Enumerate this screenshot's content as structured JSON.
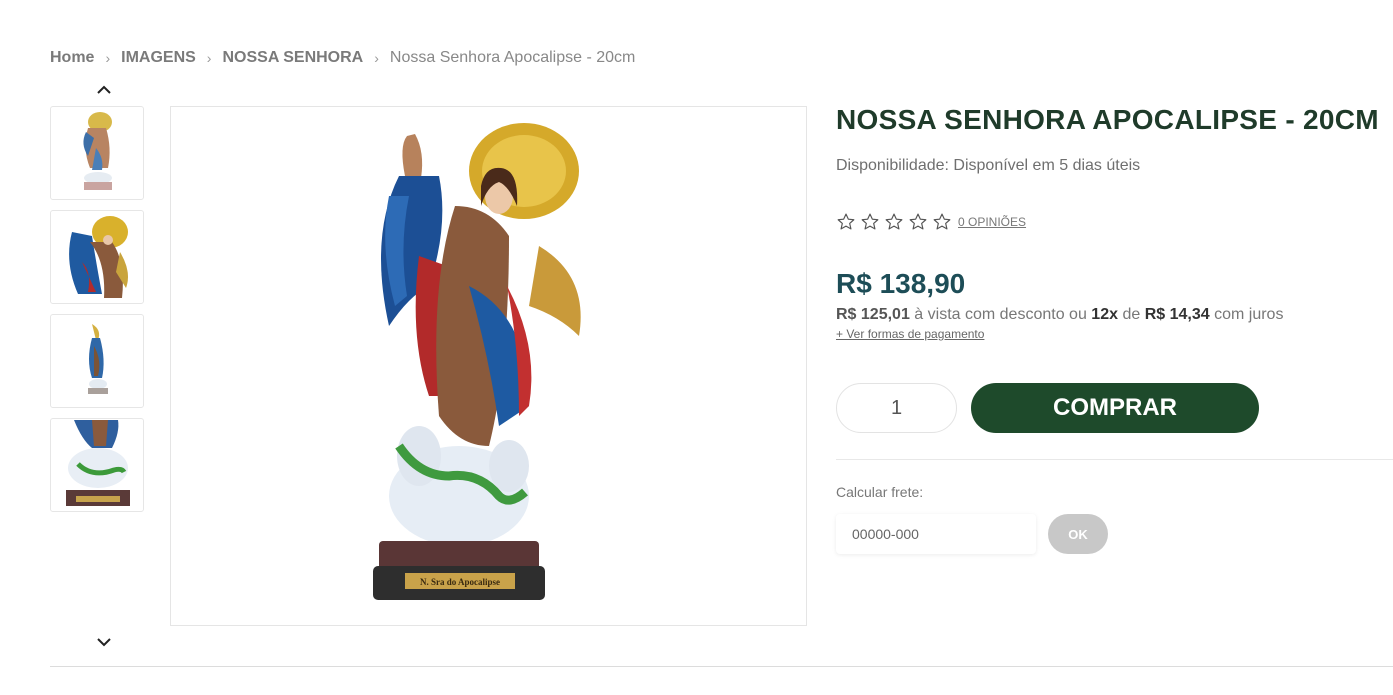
{
  "breadcrumb": {
    "items": [
      "Home",
      "IMAGENS",
      "NOSSA SENHORA"
    ],
    "current": "Nossa Senhora Apocalipse - 20cm",
    "separator": "›"
  },
  "gallery": {
    "thumbnail_count": 4,
    "up_icon": "chevron-up-icon",
    "down_icon": "chevron-down-icon",
    "main_image_plaque": "N. Sra do Apocalipse"
  },
  "product": {
    "title": "NOSSA SENHORA APOCALIPSE - 20CM",
    "availability": "Disponibilidade: Disponível em 5 dias úteis",
    "rating_stars": 0,
    "rating_max": 5,
    "reviews_label": "0 OPINIÕES",
    "price": "R$ 138,90",
    "cash_price": "R$ 125,01",
    "cash_text": "à vista com desconto ou",
    "installments_count": "12x",
    "installments_de": "de",
    "installment_value": "R$ 14,34",
    "installments_suffix": "com juros",
    "payment_link": "+ Ver formas de pagamento"
  },
  "cart": {
    "quantity": "1",
    "buy_label": "COMPRAR"
  },
  "shipping": {
    "label": "Calcular frete:",
    "placeholder": "00000-000",
    "ok_label": "OK"
  },
  "colors": {
    "title": "#1f3b2a",
    "price": "#1d4d57",
    "buy_button": "#1e4a2b",
    "ok_button": "#c8c8c8"
  }
}
